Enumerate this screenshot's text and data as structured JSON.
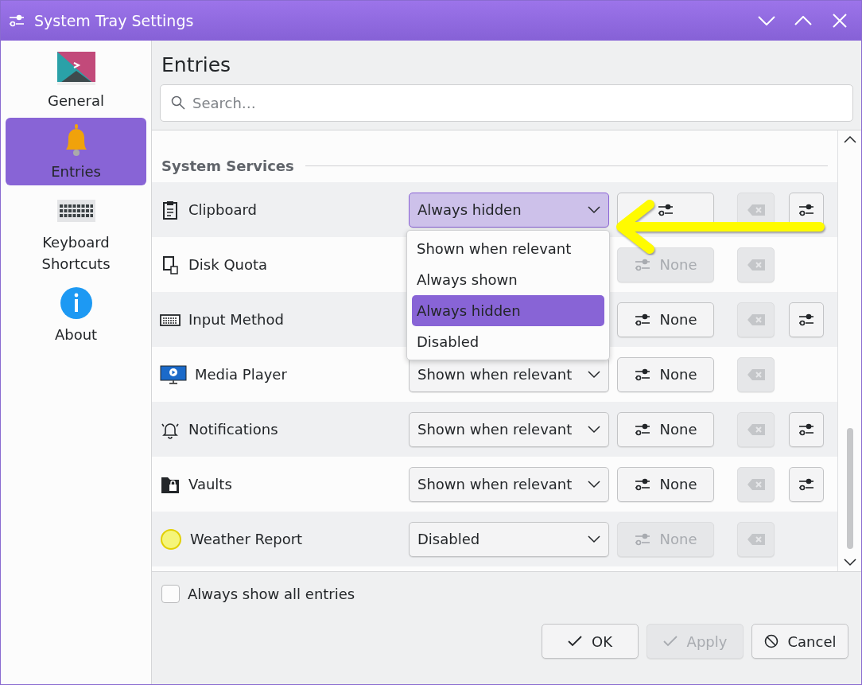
{
  "window": {
    "title": "System Tray Settings"
  },
  "sidebar": {
    "items": [
      {
        "label": "General",
        "selected": false
      },
      {
        "label": "Entries",
        "selected": true
      },
      {
        "label": "Keyboard Shortcuts",
        "selected": false
      },
      {
        "label": "About",
        "selected": false
      }
    ]
  },
  "page": {
    "title": "Entries",
    "search": {
      "placeholder": "Search…"
    }
  },
  "section": {
    "title": "System Services"
  },
  "entries": [
    {
      "name": "Clipboard",
      "visibility": "Always hidden",
      "focused": true,
      "shortcut_enabled": true,
      "has_config": true,
      "menu": {
        "options": [
          {
            "label": "Shown when relevant",
            "selected": false
          },
          {
            "label": "Always shown",
            "selected": false
          },
          {
            "label": "Always hidden",
            "selected": true
          },
          {
            "label": "Disabled",
            "selected": false
          }
        ]
      }
    },
    {
      "name": "Disk Quota",
      "shortcut": "None",
      "shortcut_enabled": false,
      "has_config": false
    },
    {
      "name": "Input Method",
      "shortcut": "None",
      "shortcut_enabled": true,
      "has_config": true
    },
    {
      "name": "Media Player",
      "visibility": "Shown when relevant",
      "focused": false,
      "shortcut": "None",
      "shortcut_enabled": true,
      "has_config": false
    },
    {
      "name": "Notifications",
      "visibility": "Shown when relevant",
      "focused": false,
      "shortcut": "None",
      "shortcut_enabled": true,
      "has_config": true
    },
    {
      "name": "Vaults",
      "visibility": "Shown when relevant",
      "focused": false,
      "shortcut": "None",
      "shortcut_enabled": true,
      "has_config": true
    },
    {
      "name": "Weather Report",
      "visibility": "Disabled",
      "focused": false,
      "shortcut": "None",
      "shortcut_enabled": false,
      "has_config": false
    }
  ],
  "footer": {
    "always_show_all": {
      "label": "Always show all entries",
      "checked": false
    }
  },
  "buttons": [
    {
      "label": "OK",
      "disabled": false
    },
    {
      "label": "Apply",
      "disabled": true
    },
    {
      "label": "Cancel",
      "disabled": false
    }
  ]
}
